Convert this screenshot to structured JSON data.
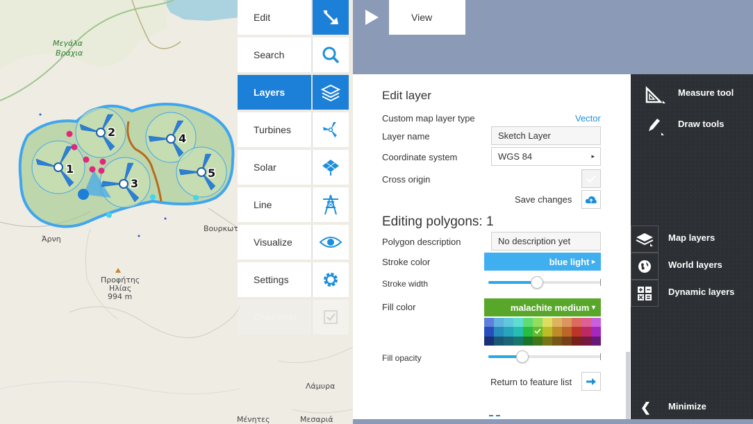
{
  "map": {
    "labels": {
      "megala_vrachia_1": "Μεγάλα",
      "megala_vrachia_2": "Βράχια",
      "arni": "Άρνη",
      "profitis_1": "Προφήτης",
      "profitis_2": "Ηλίας",
      "profitis_3": "994 m",
      "vourkoti": "Βουρκωτ",
      "lamyra": "Λάμυρα",
      "menites": "Μένητες",
      "mesaria": "Μεσαριά"
    },
    "turbines": [
      "1",
      "2",
      "3",
      "4",
      "5"
    ]
  },
  "toolbar": {
    "items": [
      {
        "label": "Edit",
        "icon": "edit-cursor-icon"
      },
      {
        "label": "Search",
        "icon": "search-icon"
      },
      {
        "label": "Layers",
        "icon": "layers-icon"
      },
      {
        "label": "Turbines",
        "icon": "turbine-icon"
      },
      {
        "label": "Solar",
        "icon": "solar-panel-icon"
      },
      {
        "label": "Line",
        "icon": "power-line-icon"
      },
      {
        "label": "Visualize",
        "icon": "eye-icon"
      },
      {
        "label": "Settings",
        "icon": "gear-icon"
      },
      {
        "label": "Checklist",
        "icon": "checklist-icon"
      }
    ],
    "active": "Layers"
  },
  "view": {
    "label": "View",
    "icon": "play-icon"
  },
  "edit_layer": {
    "title": "Edit layer",
    "custom_type_label": "Custom map layer type",
    "custom_type_value": "Vector",
    "layer_name_label": "Layer name",
    "layer_name_value": "Sketch Layer",
    "coord_label": "Coordinate system",
    "coord_value": "WGS 84",
    "cross_origin_label": "Cross origin",
    "save_changes_label": "Save changes"
  },
  "editing_polygons": {
    "title": "Editing polygons: 1",
    "desc_label": "Polygon description",
    "desc_value": "No description yet",
    "stroke_color_label": "Stroke color",
    "stroke_color_value": "blue light",
    "stroke_color_hex": "#40aff0",
    "stroke_width_label": "Stroke width",
    "stroke_width_level": 0.43,
    "fill_color_label": "Fill color",
    "fill_color_value": "malachite medium",
    "fill_color_hex": "#58a72a",
    "fill_opacity_label": "Fill opacity",
    "fill_opacity_level": 0.3,
    "return_label": "Return to feature list"
  },
  "right_panel": {
    "measure_tool": "Measure tool",
    "draw_tools": "Draw tools",
    "map_layers": "Map layers",
    "world_layers": "World layers",
    "dynamic_layers": "Dynamic layers",
    "minimize": "Minimize"
  },
  "colors": {
    "accent": "#1c7fd8",
    "dark_panel": "#2c2f33",
    "slate": "#8a9ab7"
  }
}
